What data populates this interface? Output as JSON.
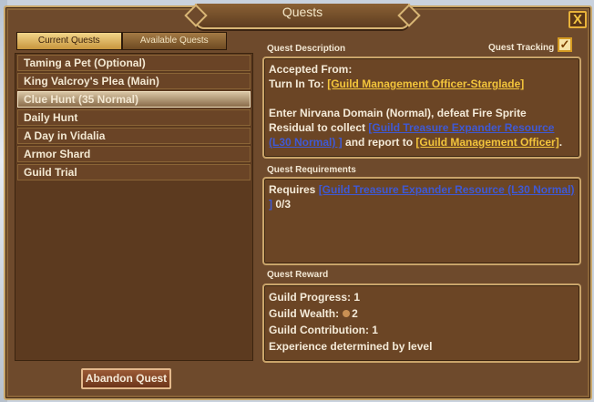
{
  "window": {
    "title": "Quests"
  },
  "tabs": {
    "current": "Current Quests",
    "available": "Available Quests"
  },
  "quests": [
    "Taming a Pet (Optional)",
    "King Valcroy's Plea (Main)",
    "Clue Hunt (35 Normal)",
    "Daily Hunt",
    "A Day in Vidalia",
    "Armor Shard",
    "Guild Trial"
  ],
  "description": {
    "label": "Quest Description",
    "tracking_label": "Quest Tracking",
    "accepted_from": "Accepted From:",
    "turn_in_prefix": "Turn In To: ",
    "turn_in_link": "[Guild Management Officer-Starglade]",
    "body_part1": "Enter Nirvana Domain (Normal), defeat Fire Sprite Residual to collect ",
    "body_item_link": "[Guild Treasure Expander Resource (L30 Normal) ]",
    "body_part2": " and report to ",
    "body_npc_link": "[Guild Management Officer]",
    "body_part3": "."
  },
  "requirements": {
    "label": "Quest Requirements",
    "prefix": "Requires ",
    "item_link": "[Guild Treasure Expander Resource (L30 Normal) ]",
    "count": " 0/3"
  },
  "reward": {
    "label": "Quest Reward",
    "progress": "Guild Progress: 1",
    "wealth_label": "Guild Wealth:",
    "wealth_value": "2",
    "contribution": "Guild Contribution: 1",
    "experience": "Experience determined by level"
  },
  "buttons": {
    "abandon": "Abandon Quest",
    "close": "X"
  }
}
